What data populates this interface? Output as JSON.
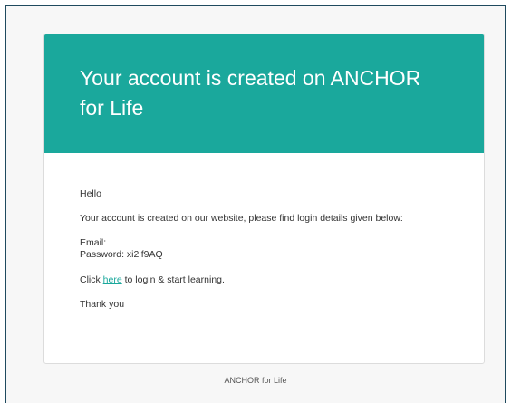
{
  "email": {
    "heading": "Your account is created on ANCHOR for Life",
    "greeting": "Hello",
    "intro": "Your account is created on our website, please find login details given below:",
    "email_label": "Email:",
    "password_line": "Password: xi2if9AQ",
    "click_prefix": "Click ",
    "link_text": "here",
    "click_suffix": " to login & start learning.",
    "thanks": "Thank you"
  },
  "footer": {
    "text": "ANCHOR for Life"
  },
  "colors": {
    "accent": "#1aa89c",
    "frame": "#1f4a5e"
  }
}
